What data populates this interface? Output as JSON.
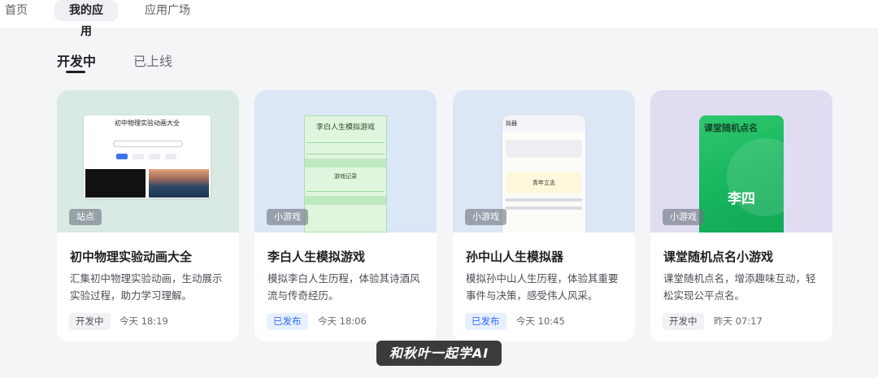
{
  "nav": {
    "home": "首页",
    "my_apps": "我的应用",
    "market": "应用广场"
  },
  "tabs": {
    "developing": "开发中",
    "launched": "已上线"
  },
  "cards": [
    {
      "badge": "站点",
      "title": "初中物理实验动画大全",
      "desc": "汇集初中物理实验动画，生动展示实验过程，助力学习理解。",
      "status": "开发中",
      "time": "今天 18:19",
      "preview": {
        "title": "初中物理实验动画大全"
      }
    },
    {
      "badge": "小游戏",
      "title": "李白人生模拟游戏",
      "desc": "模拟李白人生历程，体验其诗酒风流与传奇经历。",
      "status": "已发布",
      "time": "今天 18:06",
      "preview": {
        "title": "李白人生模拟游戏",
        "section": "游戏记录"
      }
    },
    {
      "badge": "小游戏",
      "title": "孙中山人生模拟器",
      "desc": "模拟孙中山人生历程，体验其重要事件与决策，感受伟人风采。",
      "status": "已发布",
      "time": "今天 10:45",
      "preview": {
        "header": "拟器",
        "stage": "青年立志"
      }
    },
    {
      "badge": "小游戏",
      "title": "课堂随机点名小游戏",
      "desc": "课堂随机点名，增添趣味互动，轻松实现公平点名。",
      "status": "开发中",
      "time": "昨天 07:17",
      "preview": {
        "title": "课堂随机点名",
        "name": "李四"
      }
    }
  ],
  "watermark": "和秋叶一起学AI",
  "colors": {
    "published": "#2f6bff",
    "card_bg": "#ffffff",
    "page_bg": "#f4f5f7"
  }
}
